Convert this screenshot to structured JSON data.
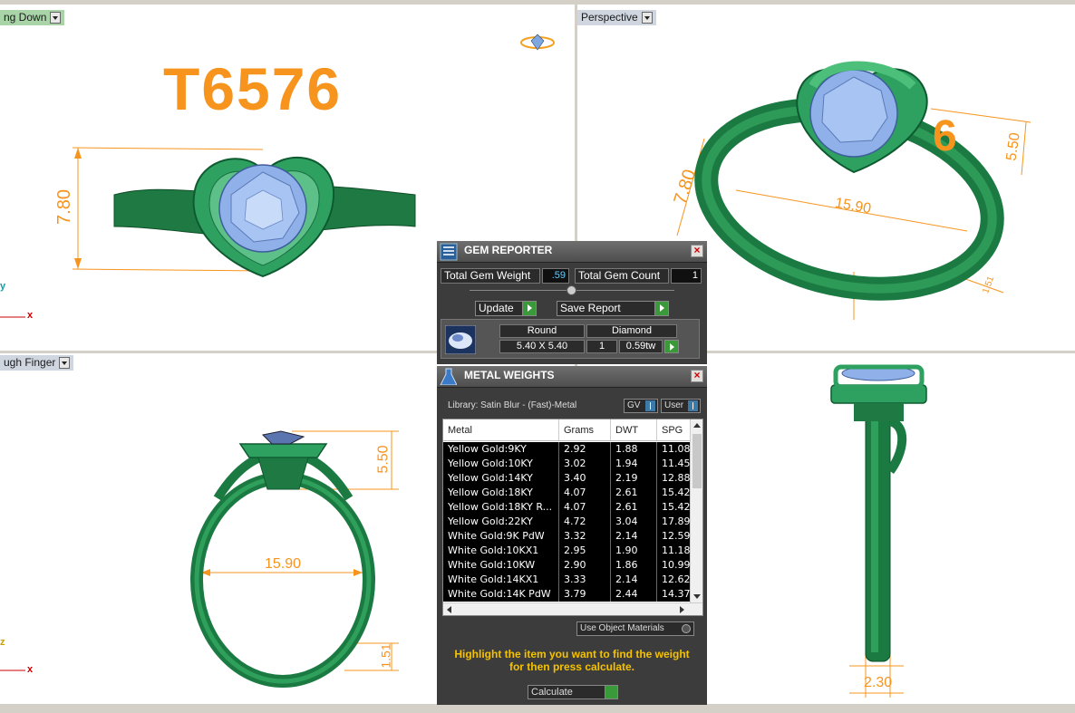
{
  "viewports": {
    "top_left": {
      "label": "ng Down",
      "title_text": "T6576",
      "dim_vertical": "7.80",
      "axis_y": "y",
      "axis_x": "x"
    },
    "top_right": {
      "label": "Perspective",
      "dim_left": "7.80",
      "dim_width": "15.90",
      "dim_right": "5.50",
      "dim_bottom": "1.51",
      "partial_text": "6"
    },
    "bottom_left": {
      "label": "ugh Finger",
      "dim_right": "5.50",
      "dim_width": "15.90",
      "dim_bottom": "1.51",
      "axis_z": "z",
      "axis_x": "x"
    },
    "bottom_right": {
      "dim_bottom": "2.30"
    }
  },
  "gem_reporter": {
    "title": "GEM REPORTER",
    "total_weight_label": "Total Gem Weight",
    "total_weight_value": ".59",
    "total_count_label": "Total Gem Count",
    "total_count_value": "1",
    "update_label": "Update",
    "save_label": "Save Report",
    "gem": {
      "shape": "Round",
      "material": "Diamond",
      "size": "5.40 X 5.40",
      "qty": "1",
      "tw": "0.59tw"
    }
  },
  "metal_weights": {
    "title": "METAL WEIGHTS",
    "library": "Library: Satin Blur - (Fast)-Metal",
    "gv_label": "GV",
    "user_label": "User",
    "columns": [
      "Metal",
      "Grams",
      "DWT",
      "SPG"
    ],
    "rows": [
      [
        "Yellow Gold:9KY",
        "2.92",
        "1.88",
        "11.08"
      ],
      [
        "Yellow Gold:10KY",
        "3.02",
        "1.94",
        "11.45"
      ],
      [
        "Yellow Gold:14KY",
        "3.40",
        "2.19",
        "12.88"
      ],
      [
        "Yellow Gold:18KY",
        "4.07",
        "2.61",
        "15.42"
      ],
      [
        "Yellow Gold:18KY R...",
        "4.07",
        "2.61",
        "15.42"
      ],
      [
        "Yellow Gold:22KY",
        "4.72",
        "3.04",
        "17.89"
      ],
      [
        "White Gold:9K PdW",
        "3.32",
        "2.14",
        "12.59"
      ],
      [
        "White Gold:10KX1",
        "2.95",
        "1.90",
        "11.18"
      ],
      [
        "White Gold:10KW",
        "2.90",
        "1.86",
        "10.99"
      ],
      [
        "White Gold:14KX1",
        "3.33",
        "2.14",
        "12.62"
      ],
      [
        "White Gold:14K PdW",
        "3.79",
        "2.44",
        "14.37"
      ]
    ],
    "use_object_materials": "Use Object Materials",
    "message": "Highlight the item you want to find the weight for then press calculate.",
    "calculate_label": "Calculate"
  },
  "colors": {
    "ring": "#1e8a4a",
    "gem": "#8fb0e8",
    "dim": "#f7941d",
    "title": "#f7941d"
  }
}
